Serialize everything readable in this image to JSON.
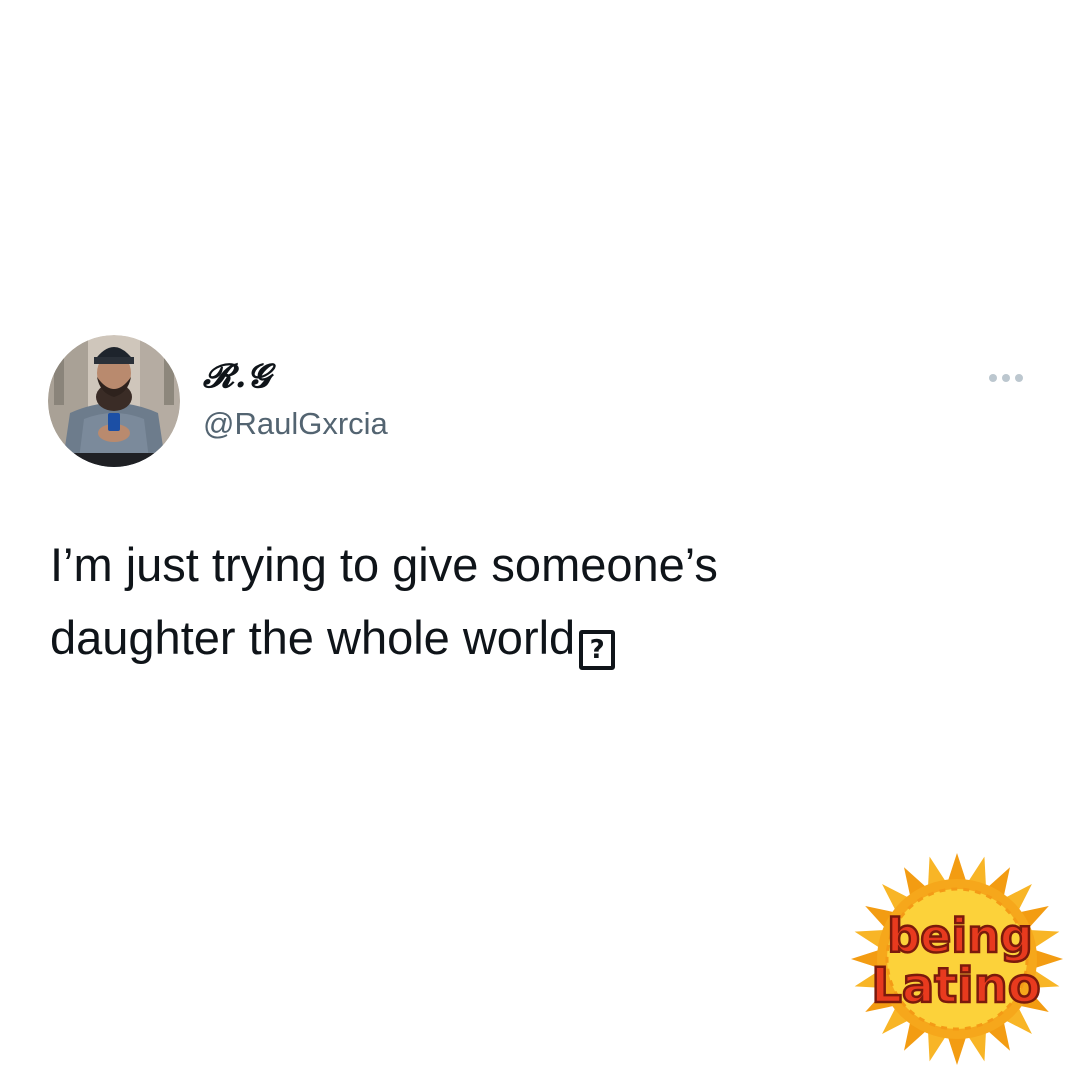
{
  "tweet": {
    "display_name": "𝓡.𝓖",
    "handle": "@RaulGxrcia",
    "text_lines": [
      "I’m just trying to give someone’s",
      "daughter the whole world"
    ],
    "emoji_placeholder": "?",
    "avatar_icon": "profile-photo",
    "more_icon": "ellipsis-icon"
  },
  "watermark": {
    "line1": "being",
    "line2": "Latino",
    "icon": "sun-logo",
    "colors": {
      "sun_outer": "#f6a71b",
      "sun_inner": "#fcd23a",
      "text_fill": "#e83a1e",
      "text_outline": "#7a1a0c"
    }
  },
  "colors": {
    "background": "#ffffff",
    "text": "#0f1419",
    "secondary": "#536471",
    "more_dots": "#bcc7cf"
  }
}
